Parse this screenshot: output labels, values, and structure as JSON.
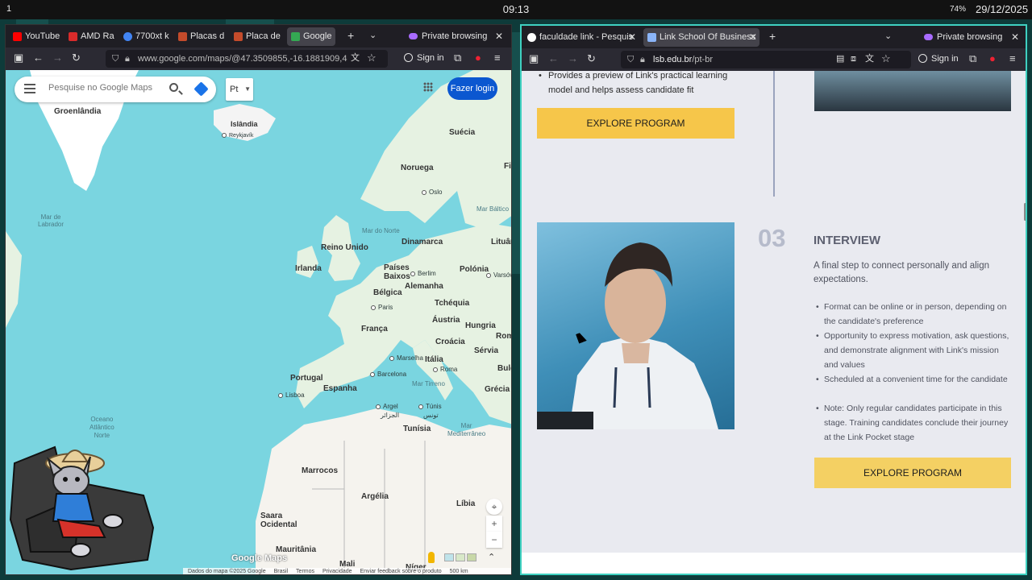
{
  "system": {
    "workspace": "1",
    "clock": "09:13",
    "battery": "74%",
    "date": "29/12/2025"
  },
  "left_window": {
    "tabs": [
      {
        "label": "YouTube",
        "fav_color": "#ff0000"
      },
      {
        "label": "AMD Ra",
        "fav_color": "#d92b2b"
      },
      {
        "label": "7700xt k",
        "fav_color": "#4285f4"
      },
      {
        "label": "Placas d",
        "fav_color": "#c44b2b"
      },
      {
        "label": "Placa de",
        "fav_color": "#c44b2b"
      },
      {
        "label": "Google",
        "fav_color": "#34a853"
      }
    ],
    "private_label": "Private browsing",
    "url": "www.google.com/maps/@47.3509855,-16.1881909,4",
    "signin": "Sign in",
    "map": {
      "search_placeholder": "Pesquise no Google Maps",
      "layer_label": "Pt",
      "login": "Fazer login",
      "labels": {
        "groenlandia": "Groenlândia",
        "islandia": "Islândia",
        "reykjavik": "Reykjavík",
        "mar_labrador": "Mar de\nLabrador",
        "suecia": "Suécia",
        "noruega": "Noruega",
        "fin": "Fin",
        "oslo": "Oslo",
        "mar_norte": "Mar do Norte",
        "mar_baltico": "Mar Báltico",
        "dinamarca": "Dinamarca",
        "lituania": "Lituân",
        "reino_unido": "Reino Unido",
        "irlanda": "Irlanda",
        "paises_baixos": "Países\nBaixos",
        "berlim": "Berlim",
        "polonia": "Polónia",
        "varsovia": "Varsóv",
        "alemanha": "Alemanha",
        "belgica": "Bélgica",
        "paris": "Paris",
        "tchequia": "Tchéquia",
        "franca": "França",
        "austria": "Áustria",
        "hungria": "Hungria",
        "roma_label": "Rom",
        "croacia": "Croácia",
        "servia": "Sérvia",
        "marselha": "Marselha",
        "italia": "Itália",
        "bulg": "Bulg",
        "roma": "Roma",
        "portugal": "Portugal",
        "barcelona": "Barcelona",
        "espanha": "Espanha",
        "lisboa": "Lisboa",
        "mar_tirreno": "Mar Tirreno",
        "grecia": "Grécia",
        "argel": "Argel",
        "argel_ar": "الجزائر",
        "tunis": "Túnis",
        "tunis_ar": "تونس",
        "oceano": "Oceano\nAtlântico\nNorte",
        "tunisia": "Tunísia",
        "mar_med": "Mar\nMediterrâneo",
        "marrocos": "Marrocos",
        "argelia": "Argélia",
        "libia": "Líbia",
        "saara": "Saara\nOcidental",
        "mauritania": "Mauritânia",
        "mali": "Mali",
        "niger": "Níger"
      },
      "footer": [
        "Dados do mapa ©2025 Google",
        "Brasil",
        "Termos",
        "Privacidade",
        "Enviar feedback sobre o produto",
        "500 km"
      ],
      "logo": "Google Maps"
    }
  },
  "right_window": {
    "tabs": [
      {
        "label": "faculdade link - Pesquis",
        "fav_color": "#ffffff"
      },
      {
        "label": "Link School Of Business",
        "fav_color": "#8ab4f8"
      }
    ],
    "private_label": "Private browsing",
    "url_host": "lsb.edu.br",
    "url_path": "/pt-br",
    "signin": "Sign in",
    "site": {
      "top_bullet": "Provides a preview of Link's practical learning model and helps assess candidate fit",
      "explore_1": "EXPLORE PROGRAM",
      "step_number": "03",
      "section_title": "INTERVIEW",
      "section_desc": "A final step to connect personally and align expectations.",
      "bullets": [
        "Format can be online or in person, depending on the candidate's preference",
        "Opportunity to express motivation, ask questions, and demonstrate alignment with Link's mission and values",
        "Scheduled at a convenient time for the candidate",
        "Note: Only regular candidates participate in this stage. Training candidates  conclude their journey at the Link Pocket stage"
      ],
      "explore_2": "EXPLORE PROGRAM"
    }
  }
}
